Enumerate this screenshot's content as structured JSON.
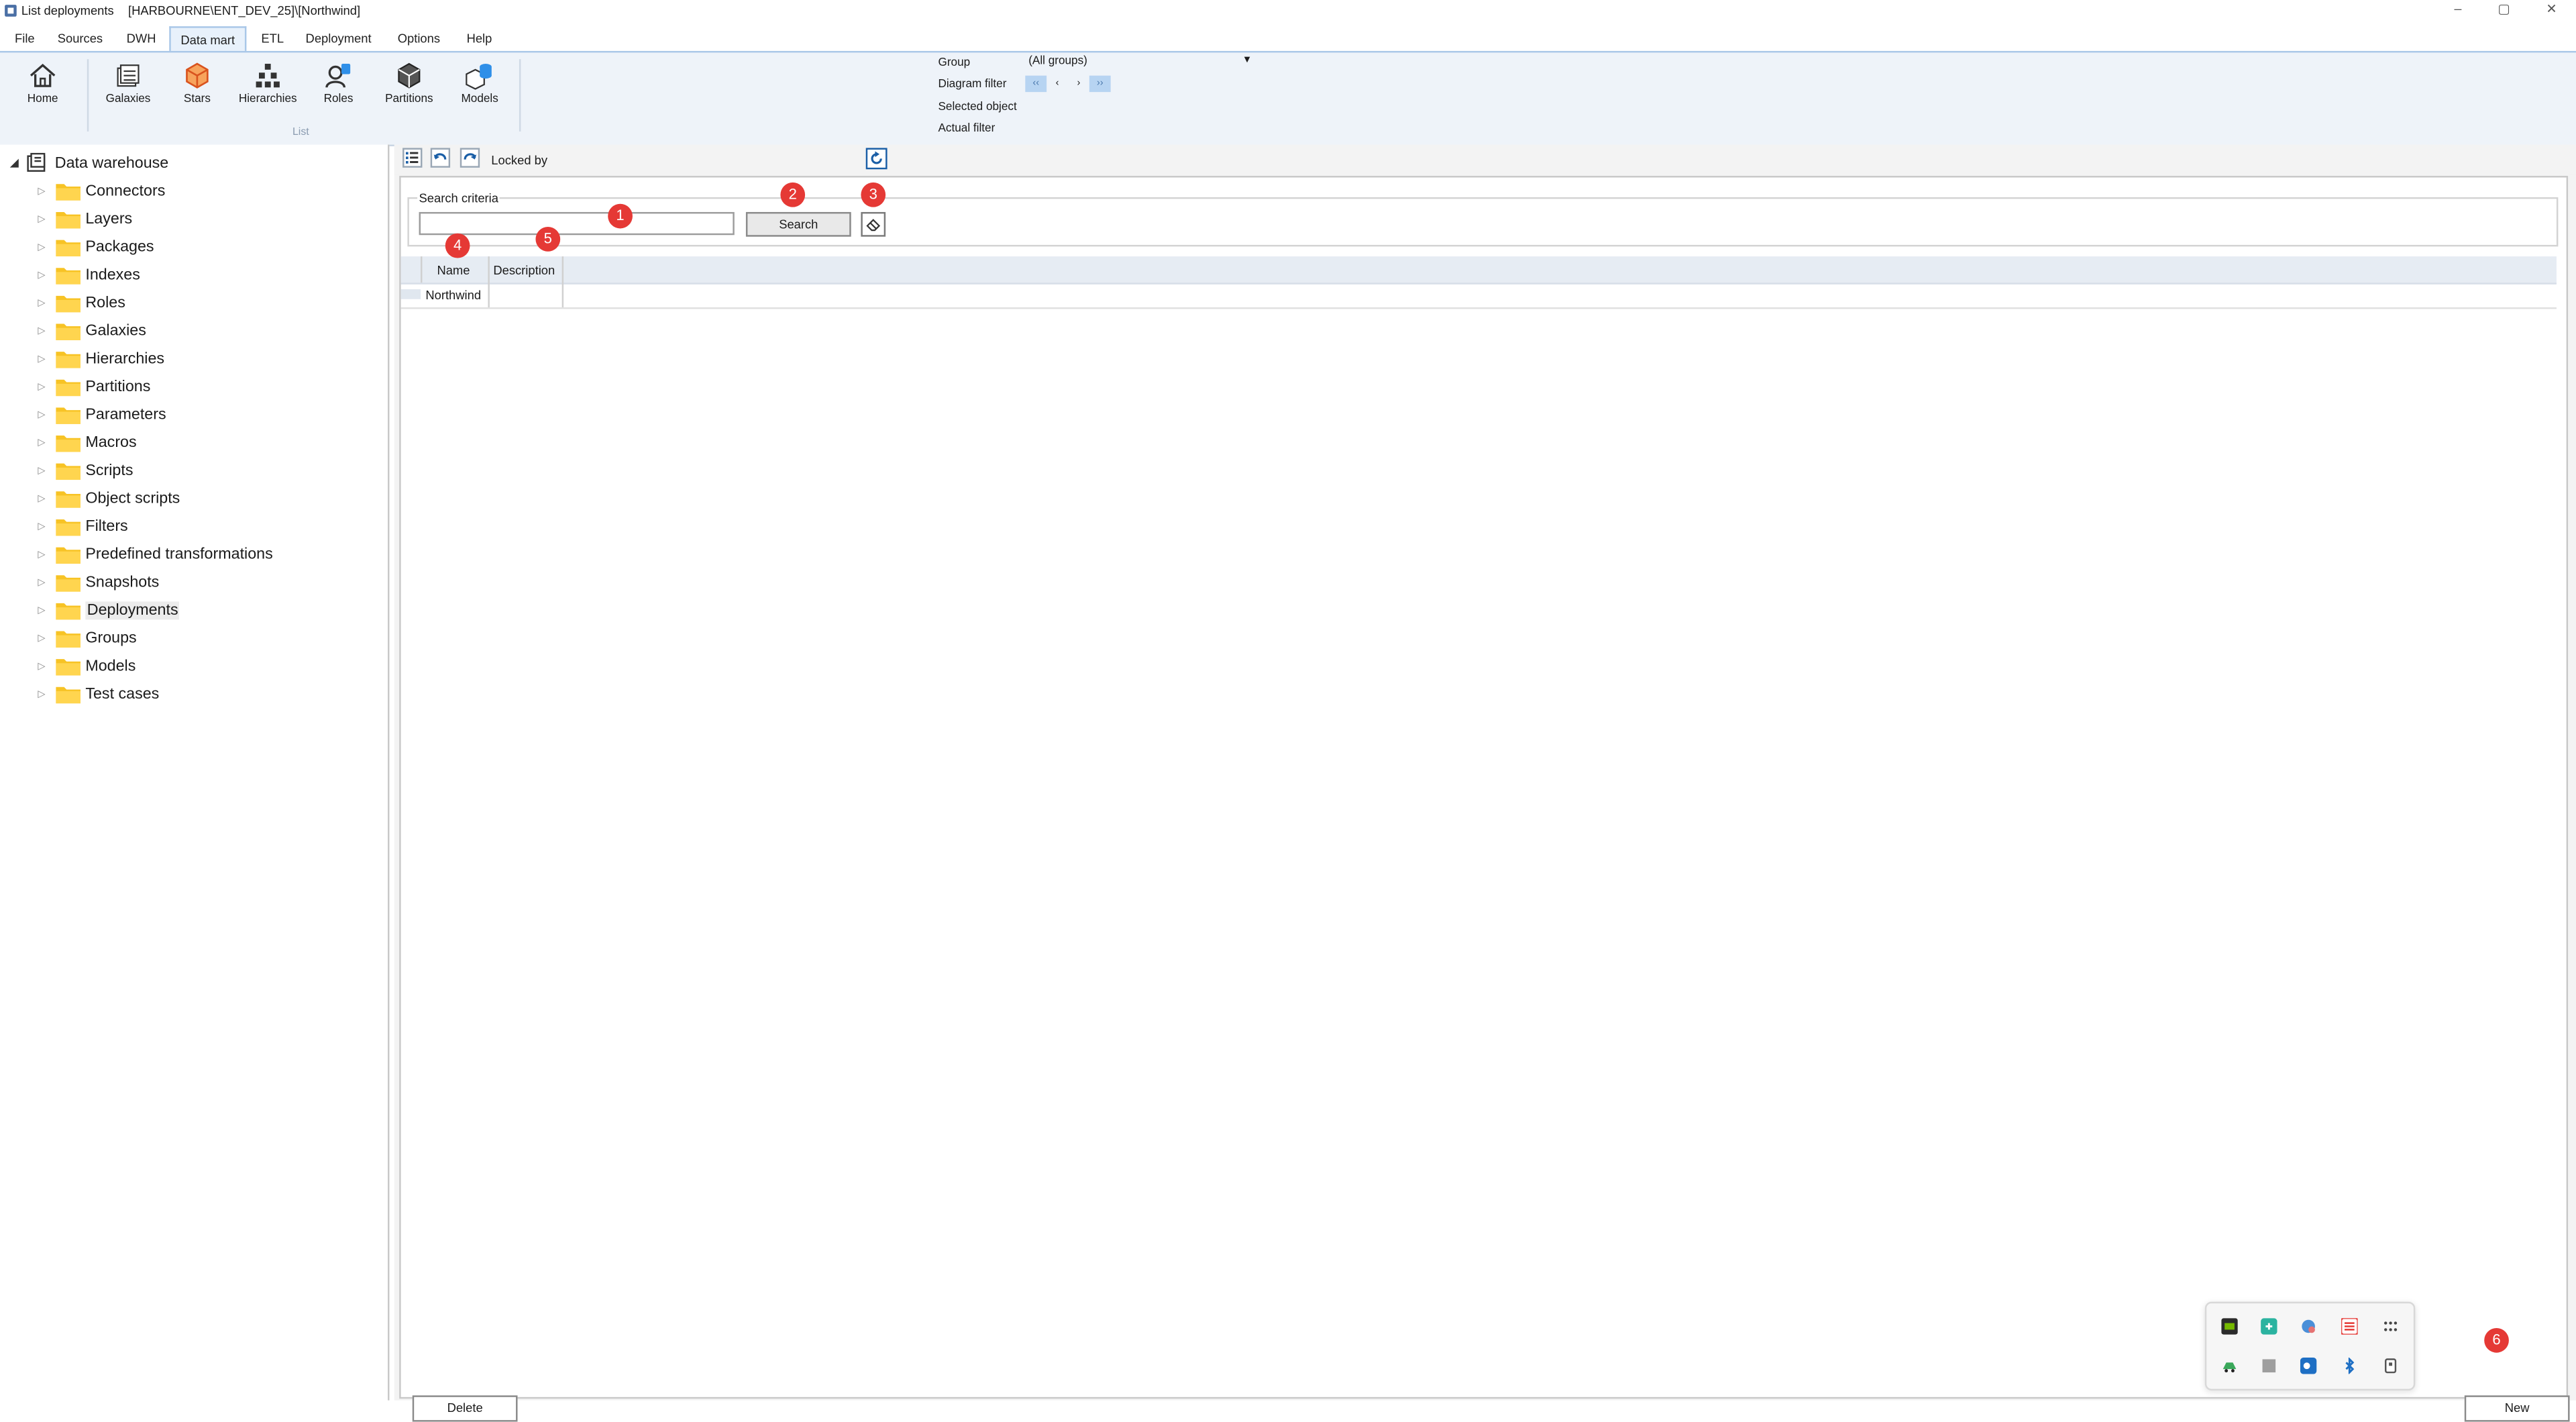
{
  "window": {
    "title": "List deployments",
    "path": "[HARBOURNE\\ENT_DEV_25]\\[Northwind]",
    "controls": [
      "–",
      "▢",
      "✕"
    ]
  },
  "menu": [
    "File",
    "Sources",
    "DWH",
    "Data mart",
    "ETL",
    "Deployment",
    "Options",
    "Help"
  ],
  "menu_active": "Data mart",
  "ribbon": {
    "buttons": [
      "Home",
      "Galaxies",
      "Stars",
      "Hierarchies",
      "Roles",
      "Partitions",
      "Models"
    ],
    "group_label": "List",
    "filters": {
      "group_label": "Group",
      "group_value": "(All groups)",
      "diagram_filter_label": "Diagram filter",
      "diagram_filter_buttons": [
        "‹‹",
        "‹",
        "›",
        "››"
      ],
      "selected_object_label": "Selected object",
      "actual_filter_label": "Actual filter"
    }
  },
  "tree": {
    "root": "Data warehouse",
    "items": [
      "Connectors",
      "Layers",
      "Packages",
      "Indexes",
      "Roles",
      "Galaxies",
      "Hierarchies",
      "Partitions",
      "Parameters",
      "Macros",
      "Scripts",
      "Object scripts",
      "Filters",
      "Predefined transformations",
      "Snapshots",
      "Deployments",
      "Groups",
      "Models",
      "Test cases"
    ],
    "selected": "Deployments"
  },
  "toolbar": {
    "locked_by_label": "Locked by",
    "locked_by_value": ""
  },
  "search": {
    "legend": "Search criteria",
    "input_value": "",
    "button_label": "Search"
  },
  "grid": {
    "columns": [
      "Name",
      "Description"
    ],
    "rows": [
      [
        "Northwind",
        ""
      ]
    ]
  },
  "buttons": {
    "delete": "Delete",
    "new": "New"
  },
  "badges": [
    "1",
    "2",
    "3",
    "4",
    "5",
    "6"
  ],
  "colors": {
    "badge": "#e53935",
    "folder": "#f7c325",
    "ribbon_bg": "#eef3f9",
    "grid_header": "#e6ecf3",
    "accent": "#1a5ea6"
  }
}
